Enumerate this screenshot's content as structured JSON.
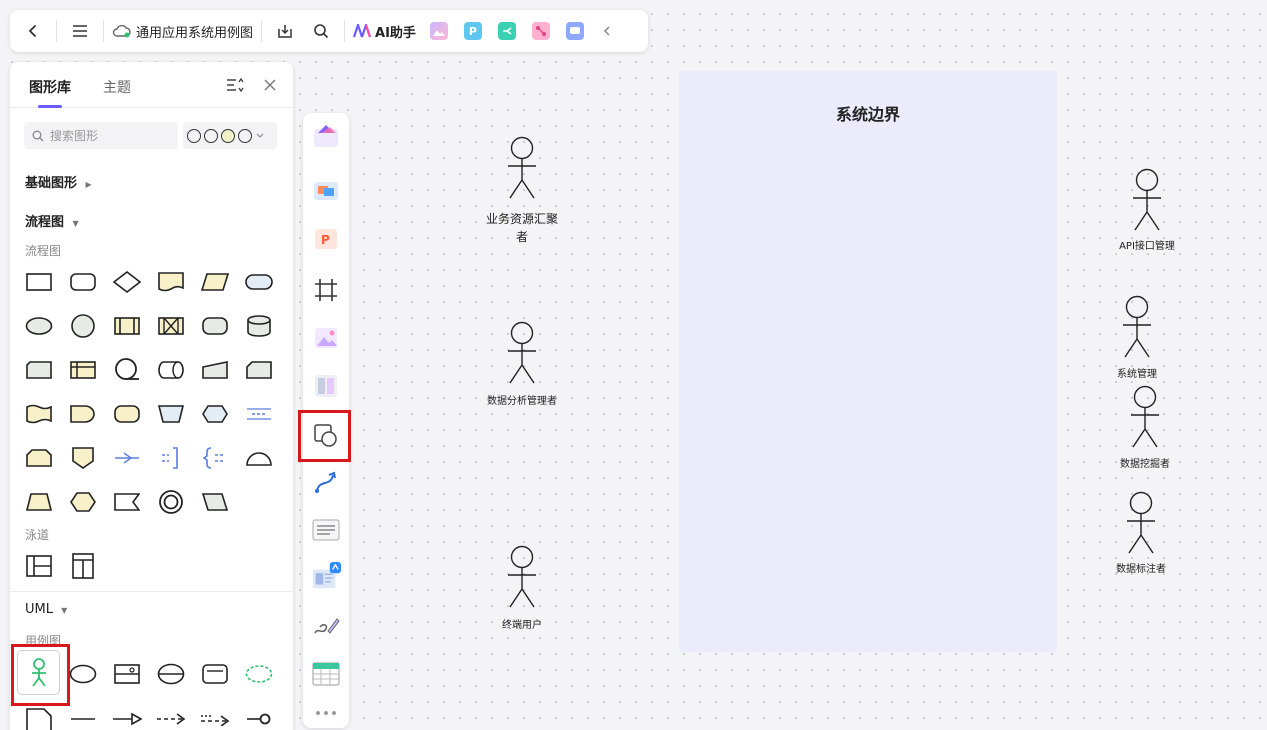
{
  "toolbar": {
    "title": "通用应用系统用例图",
    "ai_label": "AI助手"
  },
  "panel": {
    "tab_library": "图形库",
    "tab_theme": "主题",
    "search_placeholder": "搜索图形",
    "sections": {
      "basic": "基础图形",
      "flowchart": "流程图",
      "flowchart_sub": "流程图",
      "swimlane_sub": "泳道",
      "uml": "UML",
      "usecase_sub": "用例图"
    }
  },
  "canvas": {
    "boundary_title": "系统边界",
    "actors": [
      {
        "label": "业务资源汇聚者"
      },
      {
        "label": "数据分析管理者"
      },
      {
        "label": "终端用户"
      },
      {
        "label": "API接口管理"
      },
      {
        "label": "系统管理"
      },
      {
        "label": "数据挖掘者"
      },
      {
        "label": "数据标注者"
      }
    ]
  },
  "colors": {
    "accent": "#6a5cff",
    "highlight": "#d7191c",
    "boundary_fill": "#ecebfc",
    "shape_yellow": "#f8f0c8",
    "shape_grey": "#e6ebe6"
  }
}
